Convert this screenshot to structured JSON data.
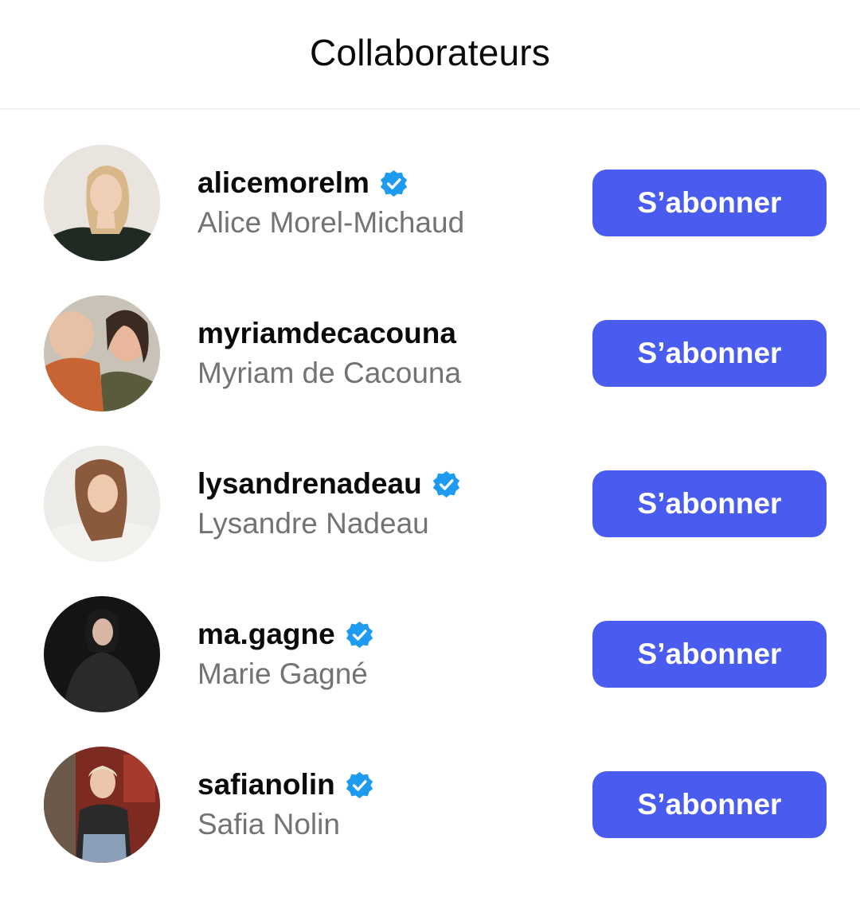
{
  "header": {
    "title": "Collaborateurs"
  },
  "colors": {
    "accent": "#4a5cf0",
    "verified_badge": "#1d9bf0",
    "secondary_text": "#737373"
  },
  "collaborators": [
    {
      "username": "alicemorelm",
      "full_name": "Alice Morel-Michaud",
      "verified": true,
      "follow_label": "S’abonner"
    },
    {
      "username": "myriamdecacouna",
      "full_name": "Myriam de Cacouna",
      "verified": false,
      "follow_label": "S’abonner"
    },
    {
      "username": "lysandrenadeau",
      "full_name": "Lysandre Nadeau",
      "verified": true,
      "follow_label": "S’abonner"
    },
    {
      "username": "ma.gagne",
      "full_name": "Marie Gagné",
      "verified": true,
      "follow_label": "S’abonner"
    },
    {
      "username": "safianolin",
      "full_name": "Safia Nolin",
      "verified": true,
      "follow_label": "S’abonner"
    }
  ]
}
